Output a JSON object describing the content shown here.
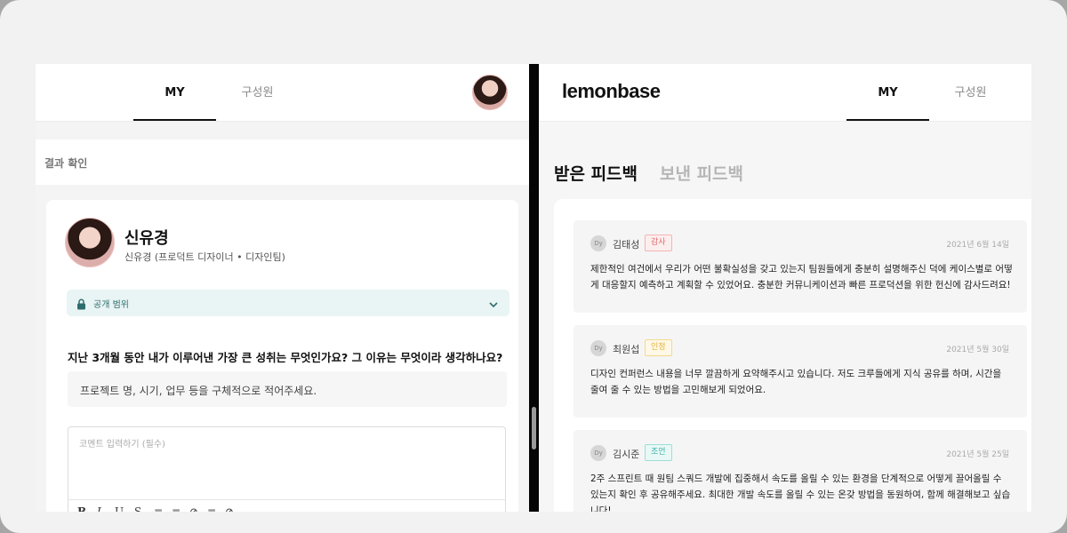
{
  "left": {
    "tabs": [
      {
        "label": "MY"
      },
      {
        "label": "구성원"
      }
    ],
    "section_title": "결과 확인",
    "profile": {
      "name": "신유경",
      "subtitle": "신유경 (프로덕트 디자이너 • 디자인팀)"
    },
    "scope_label": "공개 범위",
    "question": "지난 3개월 동안 내가 이루어낸 가장 큰 성취는 무엇인가요? 그 이유는 무엇이라 생각하나요?",
    "hint": "프로젝트 명, 시기, 업무 등을 구체적으로 적어주세요.",
    "comment_placeholder": "코멘트 입력하기 (필수)",
    "toolbar": [
      "B",
      "I",
      "U",
      "S",
      "≡",
      "≡",
      "⊘",
      "≡",
      "⊘"
    ]
  },
  "right": {
    "logo": "lemonbase",
    "tabs": [
      {
        "label": "MY"
      },
      {
        "label": "구성원"
      }
    ],
    "feedback_tabs": {
      "received": "받은 피드백",
      "sent": "보낸 피드백"
    },
    "feedbacks": [
      {
        "avatar": "Dy",
        "name": "김태성",
        "tag": "감사",
        "tag_color": "#e06b6b",
        "tag_bg": "#fdeeee",
        "date": "2021년 6월 14일",
        "text": "제한적인 여건에서 우리가 어떤 불확실성을 갖고 있는지 팀원들에게 충분히 설명해주신 덕에 케이스별로 어떻게 대응할지 예측하고 계획할 수 있었어요. 충분한 커뮤니케이션과 빠른 프로덕션을 위한 헌신에 감사드려요!"
      },
      {
        "avatar": "Dy",
        "name": "최원섭",
        "tag": "인정",
        "tag_color": "#e2b23a",
        "tag_bg": "#fff8e6",
        "date": "2021년 5월 30일",
        "text": "디자인 컨퍼런스 내용을 너무 깔끔하게 요약해주시고 있습니다. 저도 크루들에게 지식 공유를 하며, 시간을 줄여 줄 수 있는 방법을 고민해보게 되었어요."
      },
      {
        "avatar": "Dy",
        "name": "김시준",
        "tag": "조언",
        "tag_color": "#3bb3a8",
        "tag_bg": "#e8f8f6",
        "date": "2021년 5월 25일",
        "text": "2주 스프린트 때 원팀 스쿼드 개발에 집중해서 속도를 올릴 수 있는 환경을 단계적으로 어떻게 끌어올릴 수 있는지 확인 후 공유해주세요. 최대한 개발 속도를 올릴 수 있는 온갖 방법을 동원하여, 함께 해결해보고 싶습니다!"
      }
    ]
  }
}
